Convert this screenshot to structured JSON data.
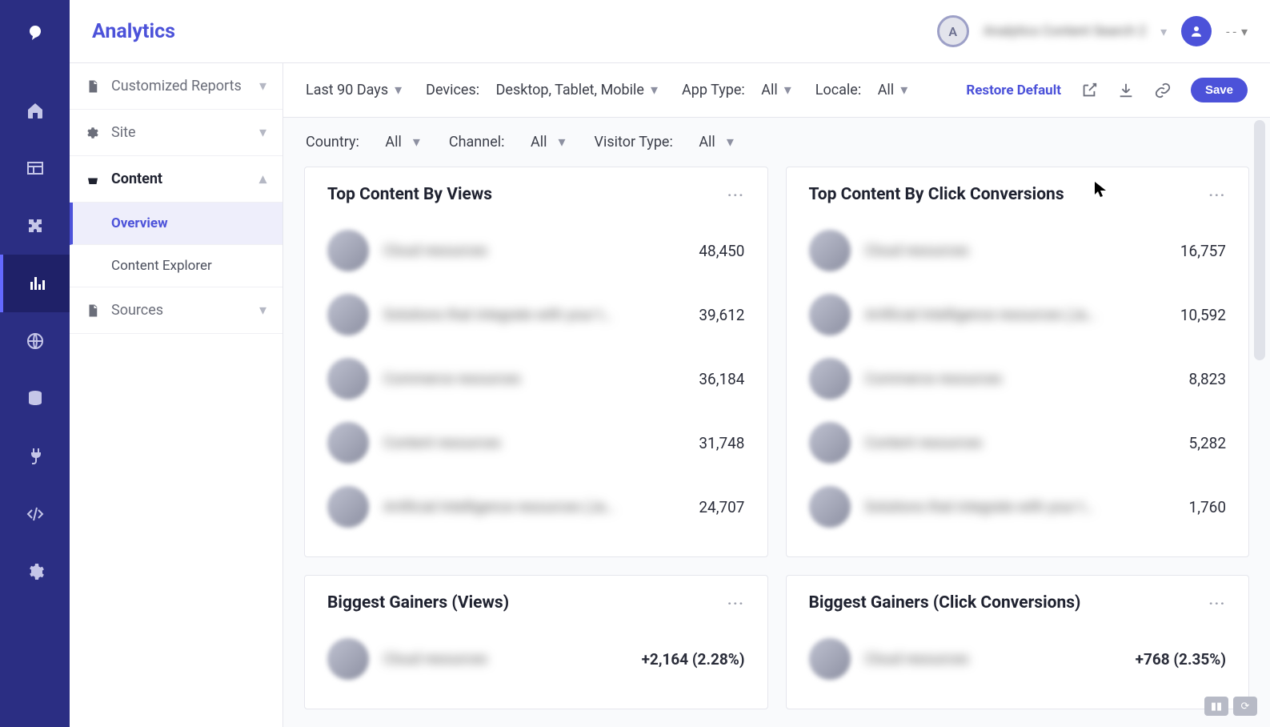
{
  "header": {
    "title": "Analytics",
    "avatar_letter": "A",
    "breadcrumb_blurred": "Analytics  Content Search  2",
    "user_menu": "- -"
  },
  "nav_rail": {
    "items": [
      "home",
      "layout",
      "puzzle",
      "analytics",
      "globe",
      "database",
      "plug",
      "code",
      "settings"
    ],
    "active_index": 3
  },
  "sidebar": {
    "items": [
      {
        "label": "Customized Reports",
        "icon": "file"
      },
      {
        "label": "Site",
        "icon": "gear"
      },
      {
        "label": "Content",
        "icon": "basket",
        "open": true,
        "children": [
          {
            "label": "Overview",
            "active": true
          },
          {
            "label": "Content Explorer"
          }
        ]
      },
      {
        "label": "Sources",
        "icon": "file"
      }
    ]
  },
  "filters": {
    "date_range": "Last 90 Days",
    "devices_label": "Devices:",
    "devices_value": "Desktop, Tablet, Mobile",
    "apptype_label": "App Type:",
    "apptype_value": "All",
    "locale_label": "Locale:",
    "locale_value": "All",
    "restore": "Restore Default",
    "save": "Save"
  },
  "subfilters": {
    "country_label": "Country:",
    "country_value": "All",
    "channel_label": "Channel:",
    "channel_value": "All",
    "visitor_label": "Visitor Type:",
    "visitor_value": "All"
  },
  "cards": {
    "top_views": {
      "title": "Top Content By Views",
      "rows": [
        {
          "label": "Cloud resources",
          "value": "48,450"
        },
        {
          "label": "Solutions that integrate with your t…",
          "value": "39,612"
        },
        {
          "label": "Commerce resources",
          "value": "36,184"
        },
        {
          "label": "Content resources",
          "value": "31,748"
        },
        {
          "label": "Artificial Intelligence resources (Ja…",
          "value": "24,707"
        }
      ]
    },
    "top_conv": {
      "title": "Top Content By Click Conversions",
      "rows": [
        {
          "label": "Cloud resources",
          "value": "16,757"
        },
        {
          "label": "Artificial Intelligence resources (Ja…",
          "value": "10,592"
        },
        {
          "label": "Commerce resources",
          "value": "8,823"
        },
        {
          "label": "Content resources",
          "value": "5,282"
        },
        {
          "label": "Solutions that integrate with your t…",
          "value": "1,760"
        }
      ]
    },
    "gainers_views": {
      "title": "Biggest Gainers (Views)",
      "rows": [
        {
          "label": "Cloud resources",
          "value": "+2,164 (2.28%)"
        }
      ]
    },
    "gainers_conv": {
      "title": "Biggest Gainers (Click Conversions)",
      "rows": [
        {
          "label": "Cloud resources",
          "value": "+768 (2.35%)"
        }
      ]
    }
  }
}
